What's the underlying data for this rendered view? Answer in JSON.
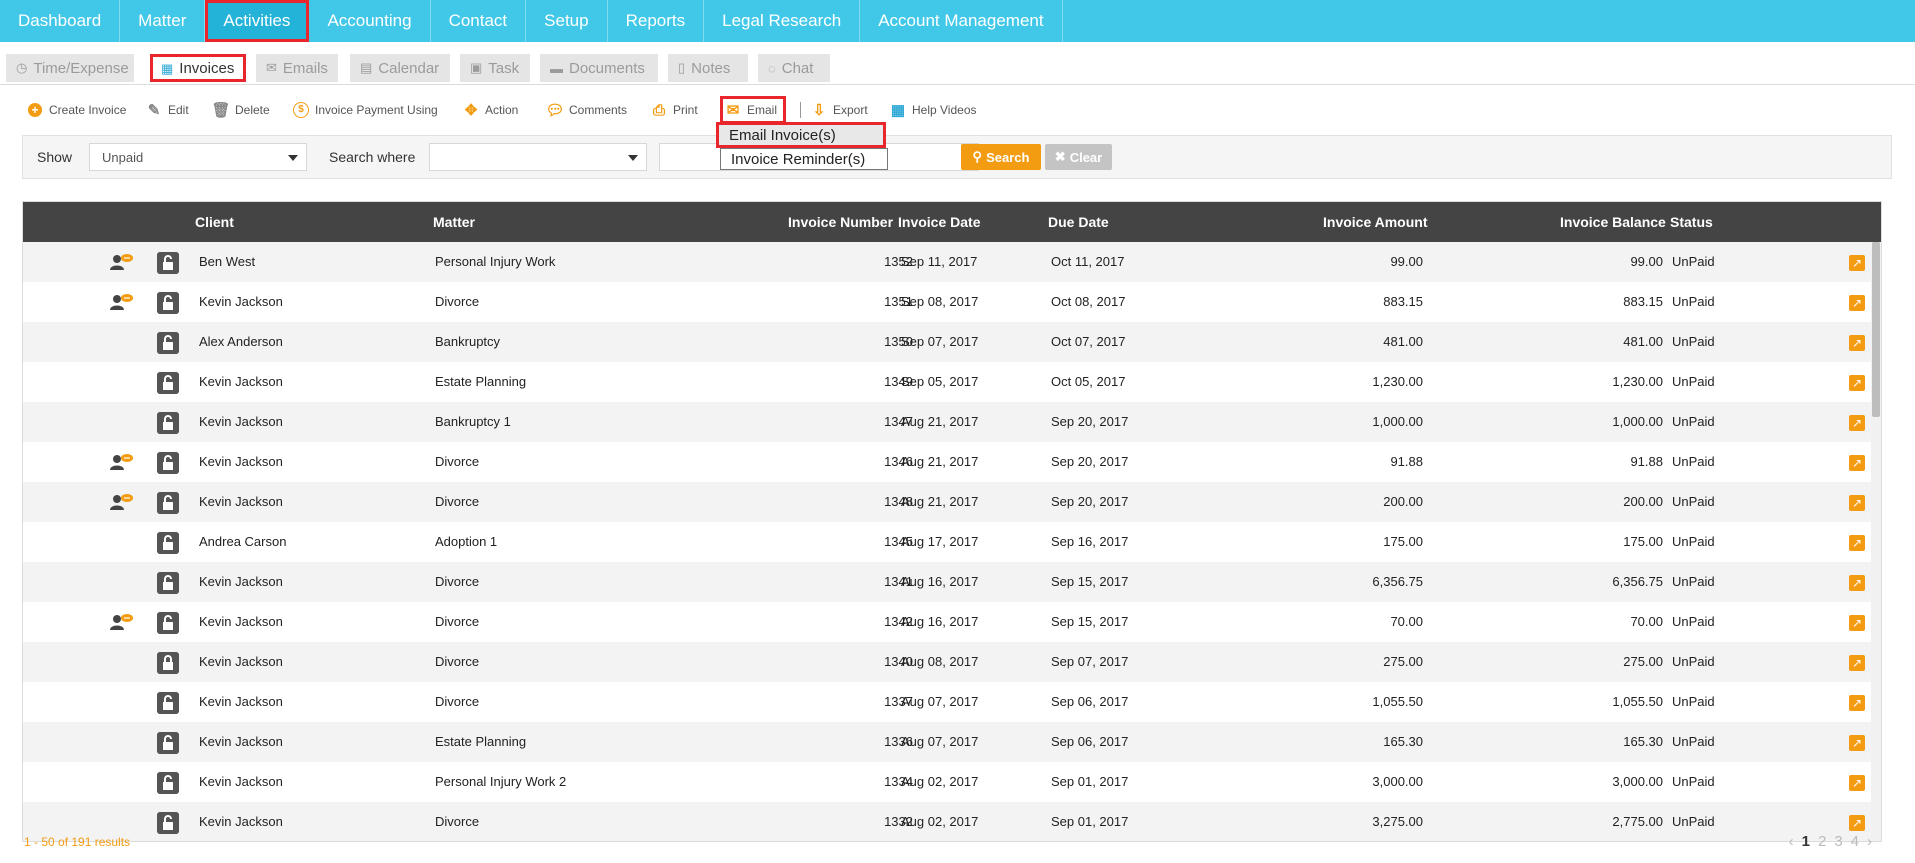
{
  "topnav": [
    "Dashboard",
    "Matter",
    "Activities",
    "Accounting",
    "Contact",
    "Setup",
    "Reports",
    "Legal Research",
    "Account Management"
  ],
  "subtabs": [
    "Time/Expense",
    "Invoices",
    "Emails",
    "Calendar",
    "Task",
    "Documents",
    "Notes",
    "Chat"
  ],
  "toolbar": {
    "create_invoice": "Create Invoice",
    "edit": "Edit",
    "delete": "Delete",
    "invoice_payment": "Invoice Payment Using",
    "action": "Action",
    "comments": "Comments",
    "print": "Print",
    "email": "Email",
    "export": "Export",
    "help_videos": "Help Videos"
  },
  "email_menu": [
    "Email Invoice(s)",
    "Invoice Reminder(s)"
  ],
  "filters": {
    "show_label": "Show",
    "show_value": "Unpaid",
    "search_where_label": "Search where",
    "search_where_value": "",
    "search_text": "",
    "search_button": "Search",
    "clear_button": "Clear"
  },
  "columns": [
    "Client",
    "Matter",
    "Invoice Number",
    "Invoice Date",
    "Due Date",
    "Invoice Amount",
    "Invoice Balance",
    "Status"
  ],
  "rows": [
    {
      "user": true,
      "client": "Ben West",
      "matter": "Personal Injury Work",
      "number": "1352",
      "date": "Sep 11, 2017",
      "due": "Oct 11, 2017",
      "amount": "99.00",
      "balance": "99.00",
      "status": "UnPaid"
    },
    {
      "user": true,
      "client": "Kevin Jackson",
      "matter": "Divorce",
      "number": "1351",
      "date": "Sep 08, 2017",
      "due": "Oct 08, 2017",
      "amount": "883.15",
      "balance": "883.15",
      "status": "UnPaid"
    },
    {
      "user": false,
      "client": "Alex Anderson",
      "matter": "Bankruptcy",
      "number": "1350",
      "date": "Sep 07, 2017",
      "due": "Oct 07, 2017",
      "amount": "481.00",
      "balance": "481.00",
      "status": "UnPaid"
    },
    {
      "user": false,
      "client": "Kevin Jackson",
      "matter": "Estate Planning",
      "number": "1349",
      "date": "Sep 05, 2017",
      "due": "Oct 05, 2017",
      "amount": "1,230.00",
      "balance": "1,230.00",
      "status": "UnPaid"
    },
    {
      "user": false,
      "client": "Kevin Jackson",
      "matter": "Bankruptcy 1",
      "number": "1347",
      "date": "Aug 21, 2017",
      "due": "Sep 20, 2017",
      "amount": "1,000.00",
      "balance": "1,000.00",
      "status": "UnPaid"
    },
    {
      "user": true,
      "client": "Kevin Jackson",
      "matter": "Divorce",
      "number": "1346",
      "date": "Aug 21, 2017",
      "due": "Sep 20, 2017",
      "amount": "91.88",
      "balance": "91.88",
      "status": "UnPaid"
    },
    {
      "user": true,
      "client": "Kevin Jackson",
      "matter": "Divorce",
      "number": "1348",
      "date": "Aug 21, 2017",
      "due": "Sep 20, 2017",
      "amount": "200.00",
      "balance": "200.00",
      "status": "UnPaid"
    },
    {
      "user": false,
      "client": "Andrea Carson",
      "matter": "Adoption 1",
      "number": "1345",
      "date": "Aug 17, 2017",
      "due": "Sep 16, 2017",
      "amount": "175.00",
      "balance": "175.00",
      "status": "UnPaid"
    },
    {
      "user": false,
      "client": "Kevin Jackson",
      "matter": "Divorce",
      "number": "1341",
      "date": "Aug 16, 2017",
      "due": "Sep 15, 2017",
      "amount": "6,356.75",
      "balance": "6,356.75",
      "status": "UnPaid"
    },
    {
      "user": true,
      "client": "Kevin Jackson",
      "matter": "Divorce",
      "number": "1342",
      "date": "Aug 16, 2017",
      "due": "Sep 15, 2017",
      "amount": "70.00",
      "balance": "70.00",
      "status": "UnPaid"
    },
    {
      "user": false,
      "client": "Kevin Jackson",
      "matter": "Divorce",
      "number": "1340",
      "date": "Aug 08, 2017",
      "due": "Sep 07, 2017",
      "amount": "275.00",
      "balance": "275.00",
      "status": "UnPaid"
    },
    {
      "user": false,
      "client": "Kevin Jackson",
      "matter": "Divorce",
      "number": "1337",
      "date": "Aug 07, 2017",
      "due": "Sep 06, 2017",
      "amount": "1,055.50",
      "balance": "1,055.50",
      "status": "UnPaid"
    },
    {
      "user": false,
      "client": "Kevin Jackson",
      "matter": "Estate Planning",
      "number": "1336",
      "date": "Aug 07, 2017",
      "due": "Sep 06, 2017",
      "amount": "165.30",
      "balance": "165.30",
      "status": "UnPaid"
    },
    {
      "user": false,
      "client": "Kevin Jackson",
      "matter": "Personal Injury Work 2",
      "number": "1334",
      "date": "Aug 02, 2017",
      "due": "Sep 01, 2017",
      "amount": "3,000.00",
      "balance": "3,000.00",
      "status": "UnPaid"
    },
    {
      "user": false,
      "client": "Kevin Jackson",
      "matter": "Divorce",
      "number": "1332",
      "date": "Aug 02, 2017",
      "due": "Sep 01, 2017",
      "amount": "3,275.00",
      "balance": "2,775.00",
      "status": "UnPaid"
    }
  ],
  "footer": {
    "results": "1 - 50 of 191 results",
    "pages": [
      "1",
      "2",
      "3",
      "4"
    ]
  }
}
